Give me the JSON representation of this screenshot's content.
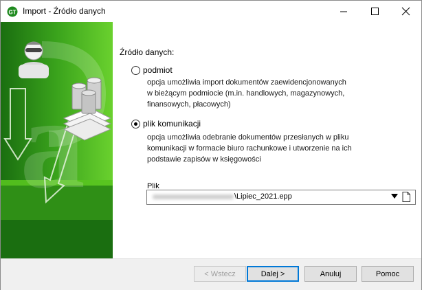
{
  "window": {
    "title": "Import - Źródło danych"
  },
  "content": {
    "source_label": "Źródło danych:",
    "options": [
      {
        "label": "podmiot",
        "selected": false,
        "description": [
          "opcja umożliwia import dokumentów zaewidencjonowanych",
          "w bieżącym podmiocie (m.in. handlowych, magazynowych,",
          "finansowych, płacowych)"
        ]
      },
      {
        "label": "plik komunikacji",
        "selected": true,
        "description": [
          "opcja umożliwia odebranie dokumentów przesłanych w pliku",
          "komunikacji w formacie biuro rachunkowe i utworzenie na ich",
          "podstawie zapisów w księgowości"
        ]
      }
    ],
    "file": {
      "label": "Plik",
      "value": "\\Lipiec_2021.epp"
    }
  },
  "buttons": {
    "back": "< Wstecz",
    "next": "Dalej >",
    "cancel": "Anuluj",
    "help": "Pomoc"
  },
  "colors": {
    "green_dark": "#1f7a12",
    "green_light": "#5ec52a",
    "accent": "#0078d7"
  }
}
